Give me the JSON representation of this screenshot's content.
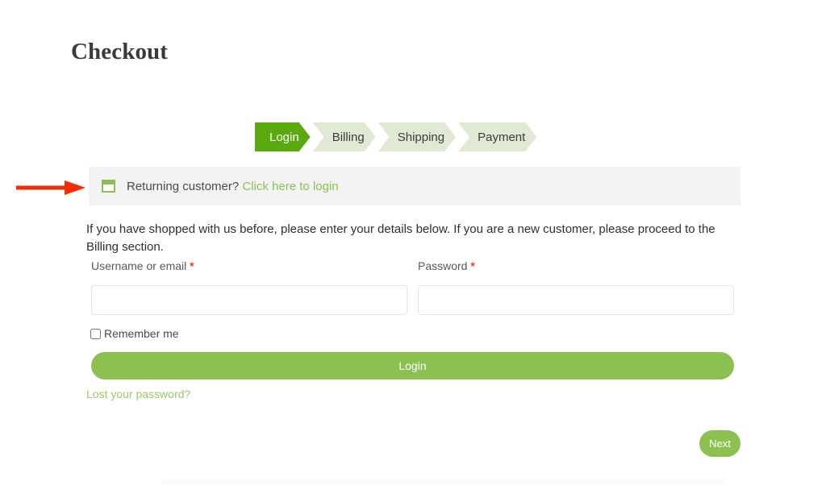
{
  "page": {
    "title": "Checkout"
  },
  "steps": [
    {
      "label": "Login",
      "active": true
    },
    {
      "label": "Billing",
      "active": false
    },
    {
      "label": "Shipping",
      "active": false
    },
    {
      "label": "Payment",
      "active": false
    }
  ],
  "returning_customer": {
    "icon": "note-icon",
    "prompt": "Returning customer?",
    "link_label": "Click here to login"
  },
  "login_form": {
    "description": "If you have shopped with us before, please enter your details below. If you are a new customer, please proceed to the Billing section.",
    "username": {
      "label": "Username or email",
      "required_marker": "*",
      "value": "",
      "placeholder": ""
    },
    "password": {
      "label": "Password",
      "required_marker": "*",
      "value": "",
      "placeholder": ""
    },
    "remember_me": {
      "label": "Remember me",
      "checked": false
    },
    "login_button": "Login",
    "lost_password_link": "Lost your password?"
  },
  "footer": {
    "next_button": "Next"
  },
  "annotation": {
    "arrow_color": "#f42d06",
    "points_to": "returning-customer-bar"
  },
  "colors": {
    "accent_green": "#8cc152",
    "active_step_green": "#5aa90f",
    "inactive_step_green": "#dfe9d3",
    "info_bar_grey": "#f3f3f3",
    "required_red": "#e8402a",
    "link_green": "#9ac96a"
  }
}
